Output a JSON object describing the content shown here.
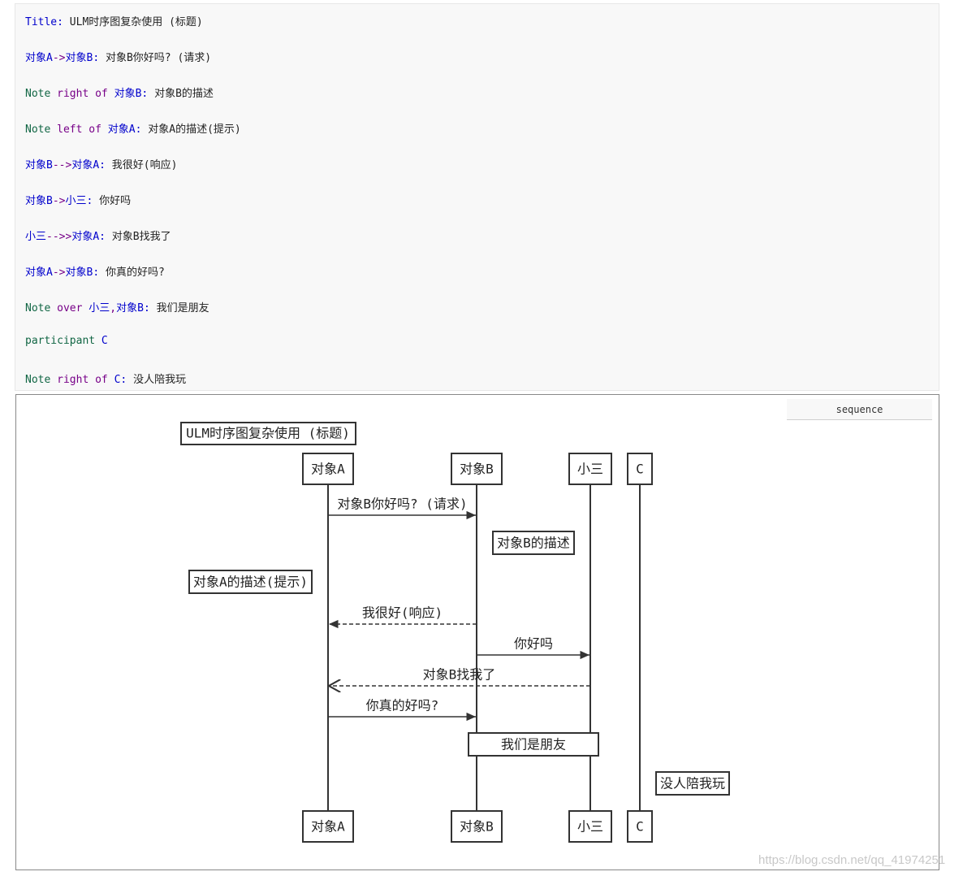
{
  "code": {
    "lines": [
      [
        {
          "t": "Title:",
          "c": "k-blue"
        },
        {
          "t": " ULM时序图复杂使用 (标题)",
          "c": "k-text"
        }
      ],
      [
        {
          "t": "对象A",
          "c": "k-blue"
        },
        {
          "t": "->",
          "c": "k-purple"
        },
        {
          "t": "对象B",
          "c": "k-blue"
        },
        {
          "t": ":",
          "c": "k-blue"
        },
        {
          "t": " 对象B你好吗? (请求)",
          "c": "k-text"
        }
      ],
      [
        {
          "t": "Note",
          "c": "k-green"
        },
        {
          "t": " right of ",
          "c": "k-purple"
        },
        {
          "t": "对象B",
          "c": "k-blue"
        },
        {
          "t": ":",
          "c": "k-blue"
        },
        {
          "t": " 对象B的描述",
          "c": "k-text"
        }
      ],
      [
        {
          "t": "Note",
          "c": "k-green"
        },
        {
          "t": " left of ",
          "c": "k-purple"
        },
        {
          "t": "对象A",
          "c": "k-blue"
        },
        {
          "t": ":",
          "c": "k-blue"
        },
        {
          "t": " 对象A的描述(提示)",
          "c": "k-text"
        }
      ],
      [
        {
          "t": "对象B",
          "c": "k-blue"
        },
        {
          "t": "-->",
          "c": "k-purple"
        },
        {
          "t": "对象A",
          "c": "k-blue"
        },
        {
          "t": ":",
          "c": "k-blue"
        },
        {
          "t": " 我很好(响应)",
          "c": "k-text"
        }
      ],
      [
        {
          "t": "对象B",
          "c": "k-blue"
        },
        {
          "t": "->",
          "c": "k-purple"
        },
        {
          "t": "小三",
          "c": "k-blue"
        },
        {
          "t": ":",
          "c": "k-blue"
        },
        {
          "t": " 你好吗",
          "c": "k-text"
        }
      ],
      [
        {
          "t": "小三",
          "c": "k-blue"
        },
        {
          "t": "-->>",
          "c": "k-purple"
        },
        {
          "t": "对象A",
          "c": "k-blue"
        },
        {
          "t": ":",
          "c": "k-blue"
        },
        {
          "t": " 对象B找我了",
          "c": "k-text"
        }
      ],
      [
        {
          "t": "对象A",
          "c": "k-blue"
        },
        {
          "t": "->",
          "c": "k-purple"
        },
        {
          "t": "对象B",
          "c": "k-blue"
        },
        {
          "t": ":",
          "c": "k-blue"
        },
        {
          "t": " 你真的好吗?",
          "c": "k-text"
        }
      ],
      [
        {
          "t": "Note",
          "c": "k-green"
        },
        {
          "t": " over ",
          "c": "k-purple"
        },
        {
          "t": "小三",
          "c": "k-blue"
        },
        {
          "t": ",",
          "c": "k-purple"
        },
        {
          "t": "对象B",
          "c": "k-blue"
        },
        {
          "t": ":",
          "c": "k-blue"
        },
        {
          "t": " 我们是朋友",
          "c": "k-text"
        }
      ],
      [
        {
          "t": "participant",
          "c": "k-green"
        },
        {
          "t": " C",
          "c": "k-blue"
        }
      ],
      [
        {
          "t": "Note",
          "c": "k-green"
        },
        {
          "t": " right of ",
          "c": "k-purple"
        },
        {
          "t": "C",
          "c": "k-blue"
        },
        {
          "t": ":",
          "c": "k-blue"
        },
        {
          "t": " 没人陪我玩",
          "c": "k-text"
        }
      ]
    ]
  },
  "language_label": "sequence",
  "diagram": {
    "title": "ULM时序图复杂使用 (标题)",
    "participants": [
      "对象A",
      "对象B",
      "小三",
      "C"
    ],
    "messages": [
      {
        "from": "对象A",
        "to": "对象B",
        "label": "对象B你好吗? (请求)",
        "style": "solid",
        "arrow": "filled"
      },
      {
        "from": "对象B",
        "to": "对象A",
        "label": "我很好(响应)",
        "style": "dashed",
        "arrow": "filled"
      },
      {
        "from": "对象B",
        "to": "小三",
        "label": "你好吗",
        "style": "solid",
        "arrow": "filled"
      },
      {
        "from": "小三",
        "to": "对象A",
        "label": "对象B找我了",
        "style": "dashed",
        "arrow": "open"
      },
      {
        "from": "对象A",
        "to": "对象B",
        "label": "你真的好吗?",
        "style": "solid",
        "arrow": "filled"
      }
    ],
    "notes": [
      {
        "label": "对象B的描述",
        "placement": "right of 对象B"
      },
      {
        "label": "对象A的描述(提示)",
        "placement": "left of 对象A"
      },
      {
        "label": "我们是朋友",
        "placement": "over 小三,对象B"
      },
      {
        "label": "没人陪我玩",
        "placement": "right of C"
      }
    ]
  },
  "watermark": "https://blog.csdn.net/qq_41974251"
}
